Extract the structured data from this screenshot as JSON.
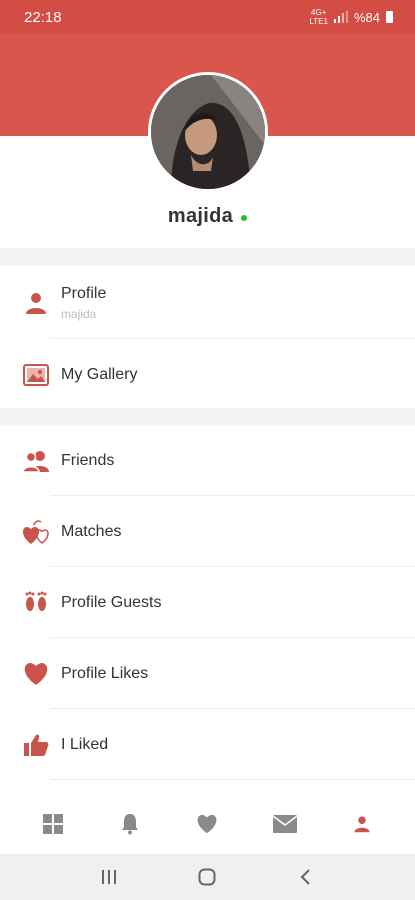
{
  "status_bar": {
    "time": "22:18",
    "network_top": "4G+",
    "network_bottom": "LTE1",
    "battery": "%84"
  },
  "profile": {
    "username": "majida",
    "online": true
  },
  "menu_group_1": [
    {
      "label": "Profile",
      "sub": "majida",
      "icon": "person-icon"
    },
    {
      "label": "My Gallery",
      "icon": "gallery-icon"
    }
  ],
  "menu_group_2": [
    {
      "label": "Friends",
      "icon": "friends-icon"
    },
    {
      "label": "Matches",
      "icon": "matches-icon"
    },
    {
      "label": "Profile Guests",
      "icon": "footprints-icon"
    },
    {
      "label": "Profile Likes",
      "icon": "heart-icon"
    },
    {
      "label": "I Liked",
      "icon": "thumbs-up-icon"
    }
  ],
  "bottom_nav": [
    {
      "name": "grid-icon",
      "active": false
    },
    {
      "name": "bell-icon",
      "active": false
    },
    {
      "name": "heart-icon",
      "active": false
    },
    {
      "name": "mail-icon",
      "active": false
    },
    {
      "name": "person-icon",
      "active": true
    }
  ],
  "colors": {
    "accent": "#d8564b",
    "status_bar": "#d44d44",
    "icon": "#c9544b",
    "nav_inactive": "#8a8a8a",
    "online": "#25c025"
  }
}
